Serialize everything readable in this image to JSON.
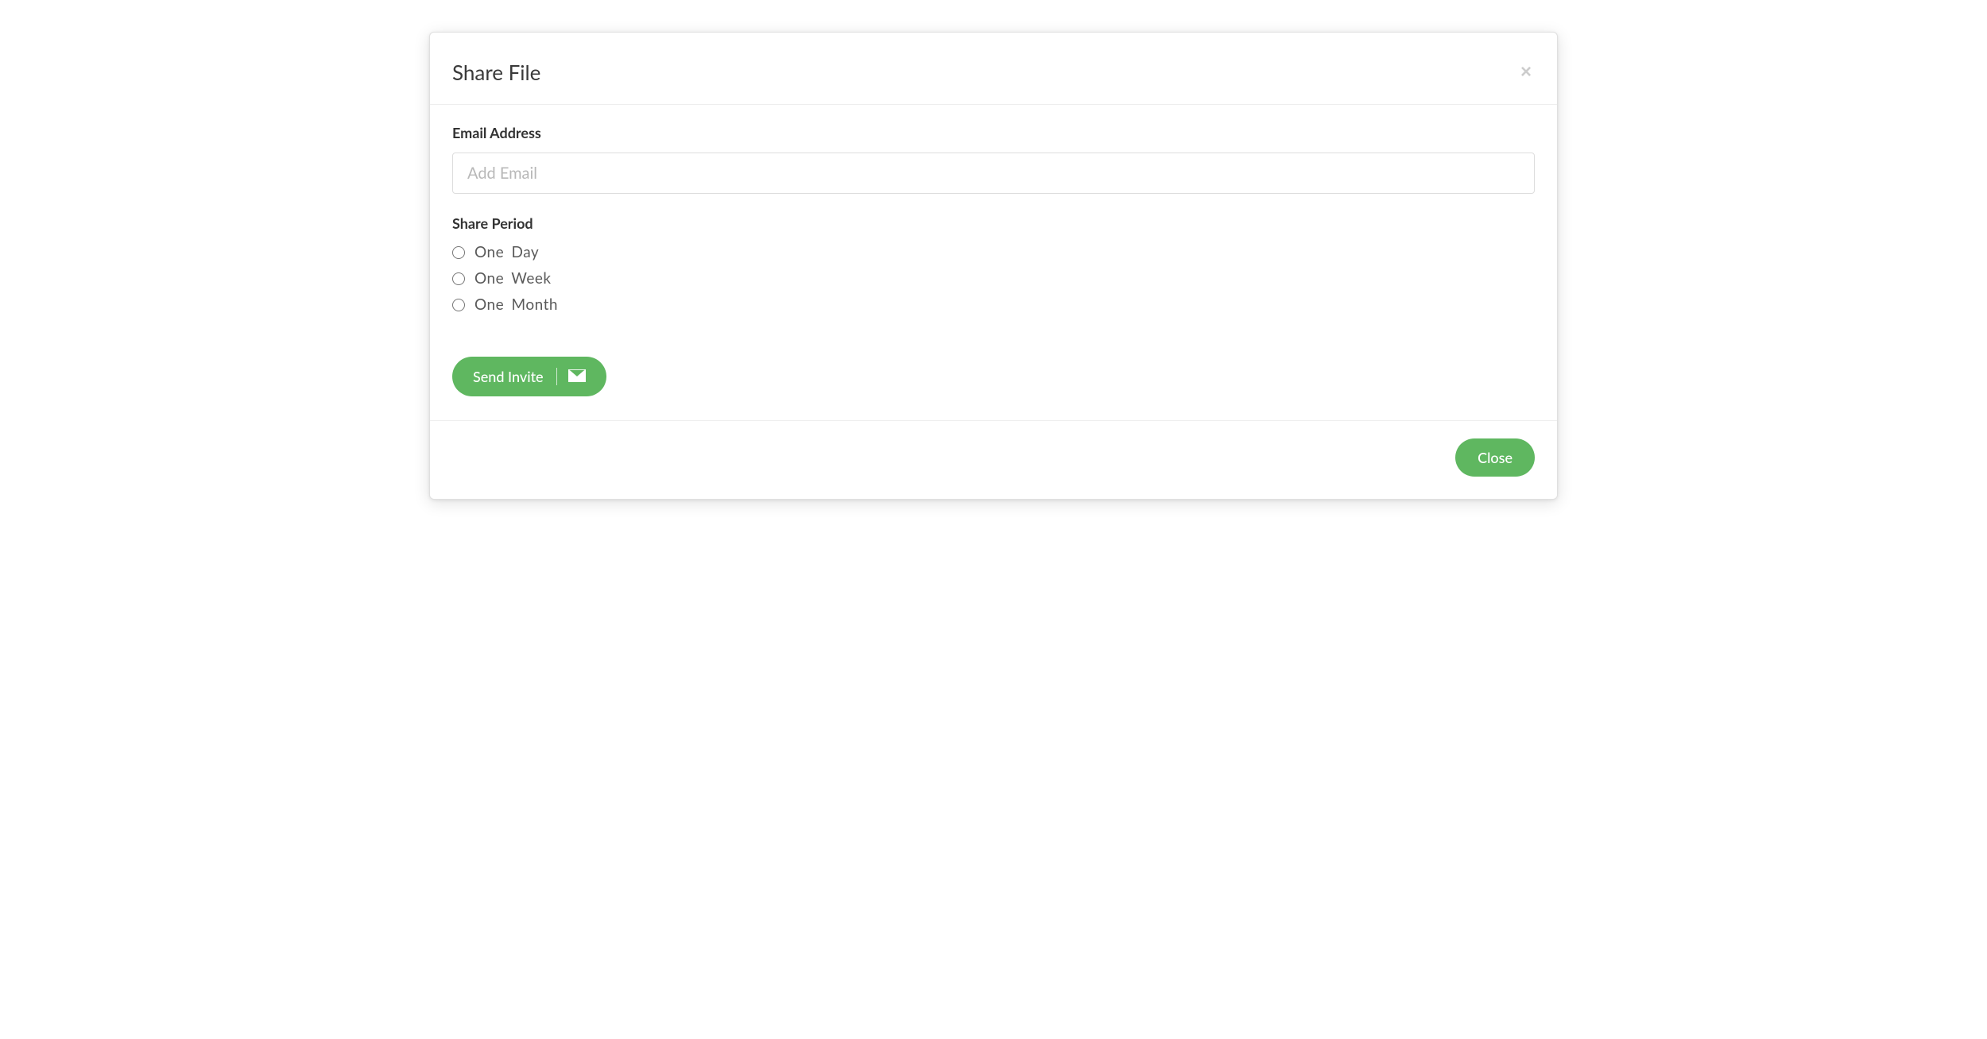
{
  "modal": {
    "title": "Share File",
    "close_x": "×"
  },
  "form": {
    "email_label": "Email Address",
    "email_placeholder": "Add Email",
    "email_value": "",
    "period_label": "Share Period",
    "period_options": [
      {
        "label": "One Day"
      },
      {
        "label": "One Week"
      },
      {
        "label": "One Month"
      }
    ],
    "send_button_label": "Send Invite"
  },
  "footer": {
    "close_label": "Close"
  },
  "colors": {
    "accent": "#5fb760"
  }
}
